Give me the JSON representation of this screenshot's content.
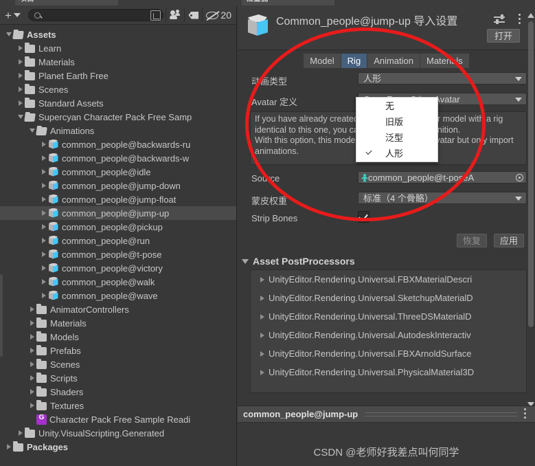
{
  "tabs_top": {
    "project_tab": "项目",
    "inspector_tab": "检查器"
  },
  "project": {
    "toolbar": {
      "add_label": "+",
      "search_placeholder": "",
      "search_value": "",
      "hidden_count": "20"
    },
    "tree": [
      {
        "label": "Assets",
        "depth": 0,
        "icon": "folder-open",
        "expanded": true,
        "bold": true,
        "selected": false
      },
      {
        "label": "Learn",
        "depth": 1,
        "icon": "folder",
        "expanded": false,
        "bold": false,
        "selected": false
      },
      {
        "label": "Materials",
        "depth": 1,
        "icon": "folder",
        "expanded": false,
        "bold": false,
        "selected": false
      },
      {
        "label": "Planet Earth Free",
        "depth": 1,
        "icon": "folder",
        "expanded": false,
        "bold": false,
        "selected": false
      },
      {
        "label": "Scenes",
        "depth": 1,
        "icon": "folder",
        "expanded": false,
        "bold": false,
        "selected": false
      },
      {
        "label": "Standard Assets",
        "depth": 1,
        "icon": "folder",
        "expanded": false,
        "bold": false,
        "selected": false
      },
      {
        "label": "Supercyan Character Pack Free Samp",
        "depth": 1,
        "icon": "folder-open",
        "expanded": true,
        "bold": false,
        "selected": false
      },
      {
        "label": "Animations",
        "depth": 2,
        "icon": "folder-open",
        "expanded": true,
        "bold": false,
        "selected": false
      },
      {
        "label": "common_people@backwards-ru",
        "depth": 3,
        "icon": "model",
        "expanded": false,
        "bold": false,
        "selected": false
      },
      {
        "label": "common_people@backwards-w",
        "depth": 3,
        "icon": "model",
        "expanded": false,
        "bold": false,
        "selected": false
      },
      {
        "label": "common_people@idle",
        "depth": 3,
        "icon": "model",
        "expanded": false,
        "bold": false,
        "selected": false
      },
      {
        "label": "common_people@jump-down",
        "depth": 3,
        "icon": "model",
        "expanded": false,
        "bold": false,
        "selected": false
      },
      {
        "label": "common_people@jump-float",
        "depth": 3,
        "icon": "model",
        "expanded": false,
        "bold": false,
        "selected": false
      },
      {
        "label": "common_people@jump-up",
        "depth": 3,
        "icon": "model",
        "expanded": false,
        "bold": false,
        "selected": true
      },
      {
        "label": "common_people@pickup",
        "depth": 3,
        "icon": "model",
        "expanded": false,
        "bold": false,
        "selected": false
      },
      {
        "label": "common_people@run",
        "depth": 3,
        "icon": "model",
        "expanded": false,
        "bold": false,
        "selected": false
      },
      {
        "label": "common_people@t-pose",
        "depth": 3,
        "icon": "model",
        "expanded": false,
        "bold": false,
        "selected": false
      },
      {
        "label": "common_people@victory",
        "depth": 3,
        "icon": "model",
        "expanded": false,
        "bold": false,
        "selected": false
      },
      {
        "label": "common_people@walk",
        "depth": 3,
        "icon": "model",
        "expanded": false,
        "bold": false,
        "selected": false
      },
      {
        "label": "common_people@wave",
        "depth": 3,
        "icon": "model",
        "expanded": false,
        "bold": false,
        "selected": false
      },
      {
        "label": "AnimatorControllers",
        "depth": 2,
        "icon": "folder",
        "expanded": false,
        "bold": false,
        "selected": false
      },
      {
        "label": "Materials",
        "depth": 2,
        "icon": "folder",
        "expanded": false,
        "bold": false,
        "selected": false
      },
      {
        "label": "Models",
        "depth": 2,
        "icon": "folder",
        "expanded": false,
        "bold": false,
        "selected": false
      },
      {
        "label": "Prefabs",
        "depth": 2,
        "icon": "folder",
        "expanded": false,
        "bold": false,
        "selected": false
      },
      {
        "label": "Scenes",
        "depth": 2,
        "icon": "folder",
        "expanded": false,
        "bold": false,
        "selected": false
      },
      {
        "label": "Scripts",
        "depth": 2,
        "icon": "folder",
        "expanded": false,
        "bold": false,
        "selected": false
      },
      {
        "label": "Shaders",
        "depth": 2,
        "icon": "folder",
        "expanded": false,
        "bold": false,
        "selected": false
      },
      {
        "label": "Textures",
        "depth": 2,
        "icon": "folder",
        "expanded": false,
        "bold": false,
        "selected": false
      },
      {
        "label": "Character Pack Free Sample Readi",
        "depth": 2,
        "icon": "pdf",
        "expanded": false,
        "bold": false,
        "selected": false
      },
      {
        "label": "Unity.VisualScripting.Generated",
        "depth": 1,
        "icon": "folder",
        "expanded": false,
        "bold": false,
        "selected": false
      },
      {
        "label": "Packages",
        "depth": 0,
        "icon": "folder",
        "expanded": false,
        "bold": true,
        "selected": false
      }
    ]
  },
  "inspector": {
    "title": "Common_people@jump-up 导入设置",
    "open_button": "打开",
    "tabs": [
      {
        "label": "Model",
        "active": false
      },
      {
        "label": "Rig",
        "active": true
      },
      {
        "label": "Animation",
        "active": false
      },
      {
        "label": "Materials",
        "active": false
      }
    ],
    "fields": {
      "animation_type_label": "动画类型",
      "animation_type_value": "人形",
      "avatar_def_label": "Avatar 定义",
      "avatar_def_value": "Copy From Other Avatar",
      "help_text": "If you have already created an avatar for another model with a rig identical to this one, you can copy its Avatar definition.\nWith this option, this model will not create any avatar but only import animations.",
      "source_label": "Source",
      "source_value": "common_people@t-poseA",
      "skin_weights_label": "蒙皮权重",
      "skin_weights_value": "标准（4 个骨骼）",
      "strip_bones_label": "Strip Bones",
      "strip_bones_checked": true
    },
    "buttons": {
      "revert": "恢复",
      "apply": "应用"
    },
    "postprocessors": {
      "header": "Asset PostProcessors",
      "items": [
        "UnityEditor.Rendering.Universal.FBXMaterialDescri",
        "UnityEditor.Rendering.Universal.SketchupMaterialD",
        "UnityEditor.Rendering.Universal.ThreeDSMaterialD",
        "UnityEditor.Rendering.Universal.AutodeskInteractiv",
        "UnityEditor.Rendering.Universal.FBXArnoldSurface",
        "UnityEditor.Rendering.Universal.PhysicalMaterial3D"
      ]
    },
    "footer": {
      "asset_name": "common_people@jump-up"
    },
    "watermark": "CSDN @老师好我差点叫何同学"
  },
  "dropdown_popup": {
    "options": [
      {
        "label": "无",
        "checked": false
      },
      {
        "label": "旧版",
        "checked": false
      },
      {
        "label": "泛型",
        "checked": false
      },
      {
        "label": "人形",
        "checked": true
      }
    ]
  },
  "annotation": {
    "circle_color": "#e81b1b"
  }
}
